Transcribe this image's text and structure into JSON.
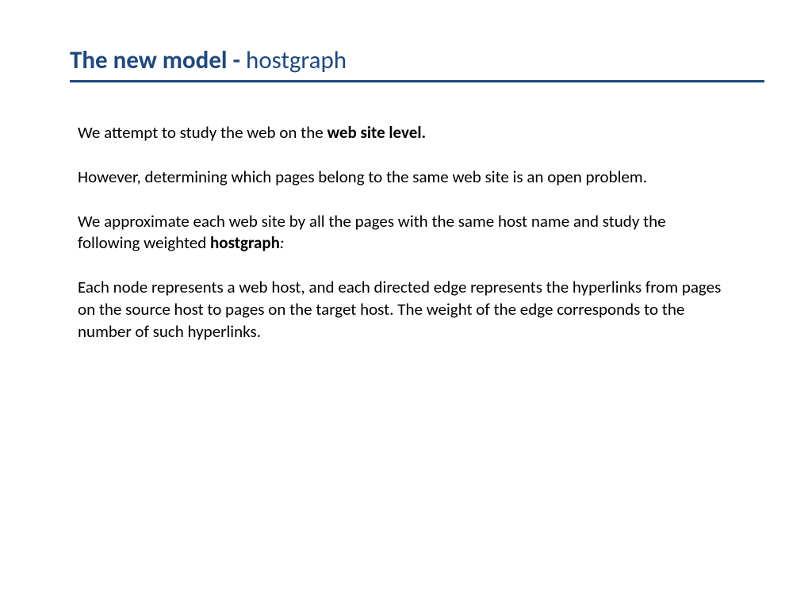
{
  "title": {
    "bold_part": "The new model - ",
    "light_part": "hostgraph"
  },
  "content": {
    "p1_pre": "We attempt to study the web on the ",
    "p1_bold": "web site level.",
    "p2": "However, determining which pages belong to the same web site is an open problem.",
    "p3_pre": "We approximate each web site by all the pages with the same host name and study the following weighted ",
    "p3_bold": "hostgraph",
    "p3_colon": ":",
    "p4": "Each node represents a web host, and each directed edge represents the hyperlinks from pages on the source host to pages on the target host. The weight of the edge corresponds to the number of such hyperlinks."
  }
}
